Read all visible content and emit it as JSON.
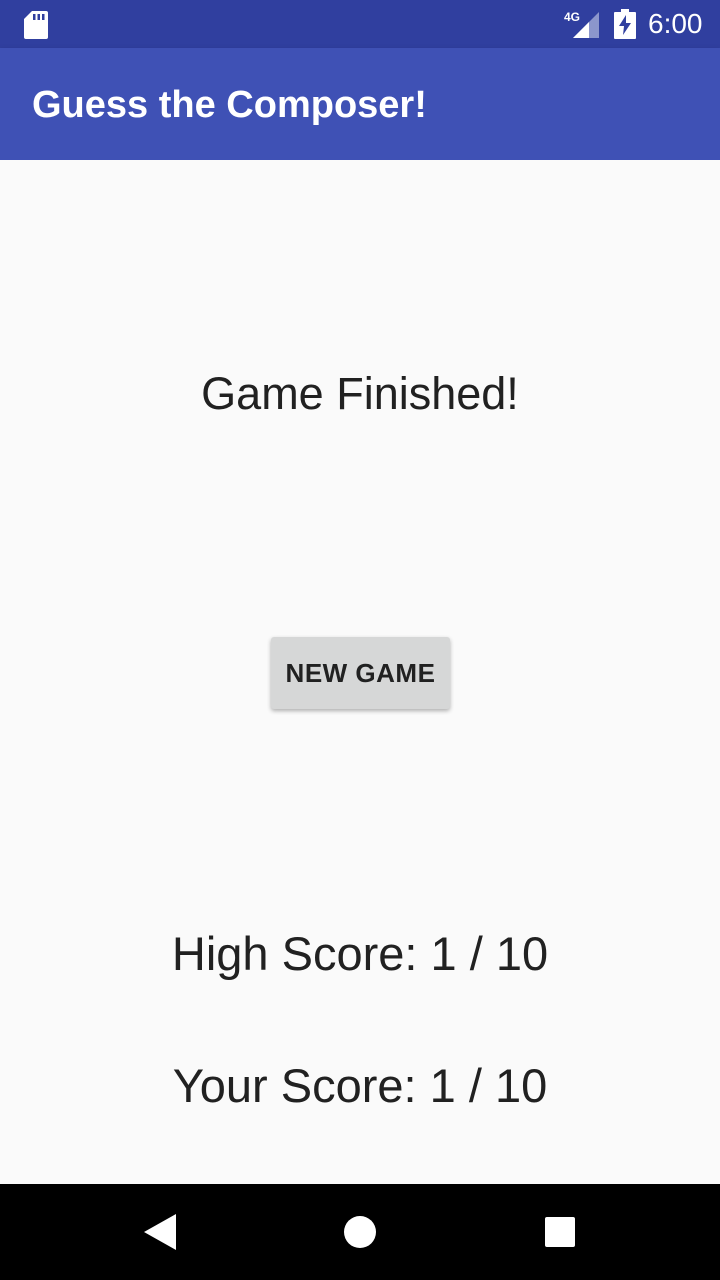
{
  "status_bar": {
    "network_label": "4G",
    "time": "6:00",
    "icons": [
      "sd-card-icon",
      "signal-icon",
      "battery-charging-icon"
    ]
  },
  "app_bar": {
    "title": "Guess the Composer!",
    "color": "#3f51b5",
    "status_color": "#303f9f"
  },
  "main": {
    "finish_message": "Game Finished!",
    "new_game_button": "NEW GAME",
    "high_score": "High Score: 1 / 10",
    "your_score": "Your Score: 1 / 10"
  },
  "nav_bar": {
    "icons": [
      "back-icon",
      "home-icon",
      "recents-icon"
    ]
  }
}
